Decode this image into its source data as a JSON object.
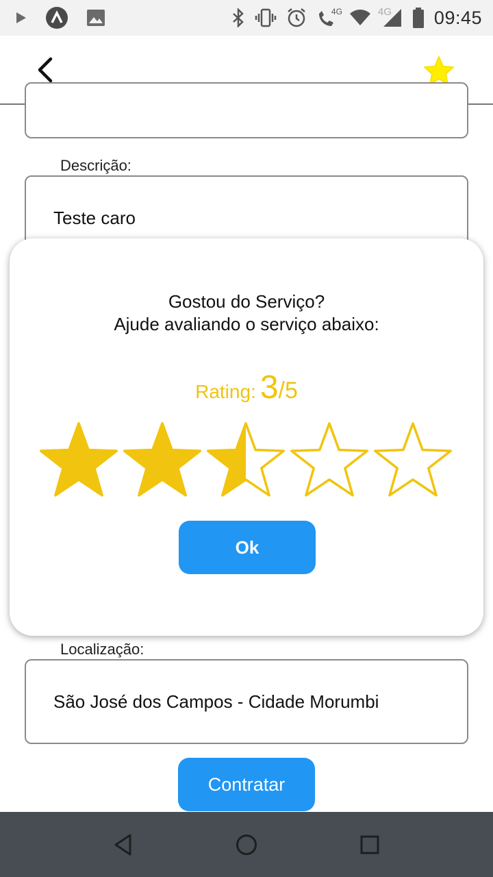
{
  "status_bar": {
    "time": "09:45",
    "network_labels": [
      "4G",
      "4G"
    ],
    "icons": [
      "play-icon",
      "app-notification-icon",
      "image-icon",
      "bluetooth-icon",
      "vibrate-icon",
      "alarm-icon",
      "call-4g-icon",
      "wifi-icon",
      "signal-icon",
      "battery-icon"
    ]
  },
  "app_bar": {
    "back_icon": "chevron-left-icon",
    "favorite_icon": "star-icon",
    "favorite_color": "#ffee00"
  },
  "form": {
    "description_label": "Descrição:",
    "description_value": "Teste caro",
    "location_label": "Localização:",
    "location_value": "São José dos Campos - Cidade Morumbi",
    "hire_button": "Contratar"
  },
  "rating_dialog": {
    "line1": "Gostou do Serviço?",
    "line2": "Ajude avaliando o serviço abaixo:",
    "rating_prefix": "Rating:",
    "rating_value": "3",
    "rating_max": "/5",
    "star_fill_levels": [
      1,
      1,
      0.5,
      0,
      0
    ],
    "star_color": "#f1c40f",
    "ok_button": "Ok"
  },
  "colors": {
    "primary": "#2196f3",
    "navbar": "#474d52",
    "accent_gold": "#f1c40f"
  },
  "nav_bar": {
    "icons": [
      "back-triangle-icon",
      "home-circle-icon",
      "recents-square-icon"
    ]
  }
}
